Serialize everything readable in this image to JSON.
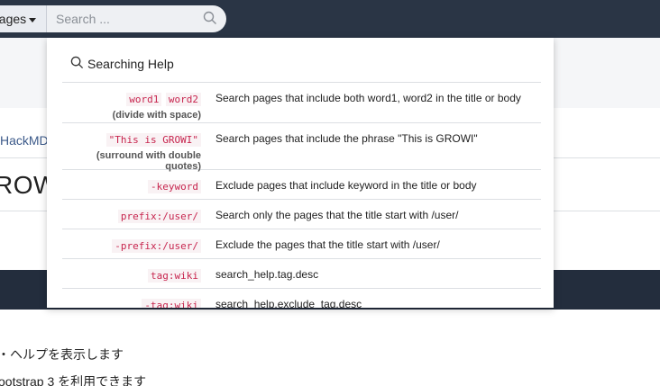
{
  "navbar": {
    "scope_label": "pages",
    "search_placeholder": "Search ..."
  },
  "page": {
    "breadcrumb": "HackMD",
    "title": "ROW",
    "body_lines": [
      "・ヘルプを表示します",
      "ootstrap 3 を利用できます"
    ]
  },
  "help": {
    "title": "Searching Help",
    "rows": [
      {
        "codes": [
          "word1",
          "word2"
        ],
        "note": "(divide with space)",
        "desc": "Search pages that include both word1, word2 in the title or body"
      },
      {
        "codes": [
          "\"This is GROWI\""
        ],
        "note": "(surround with double quotes)",
        "desc": "Search pages that include the phrase \"This is GROWI\""
      },
      {
        "codes": [
          "-keyword"
        ],
        "note": "",
        "desc": "Exclude pages that include keyword in the title or body"
      },
      {
        "codes": [
          "prefix:/user/"
        ],
        "note": "",
        "desc": "Search only the pages that the title start with /user/"
      },
      {
        "codes": [
          "-prefix:/user/"
        ],
        "note": "",
        "desc": "Exclude the pages that the title start with /user/"
      },
      {
        "codes": [
          "tag:wiki"
        ],
        "note": "",
        "desc": "search_help.tag.desc"
      },
      {
        "codes": [
          "-tag:wiki"
        ],
        "note": "",
        "desc": "search_help.exclude_tag.desc"
      }
    ]
  },
  "colors": {
    "navbar_bg": "#2a3545",
    "code_text": "#c7254e",
    "code_bg": "#f9f2f4"
  }
}
